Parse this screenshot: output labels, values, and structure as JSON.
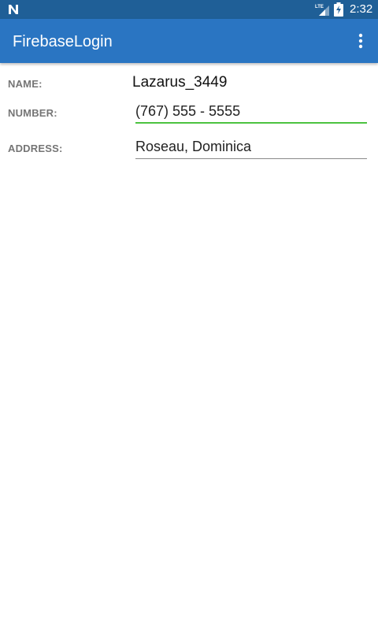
{
  "status_bar": {
    "time": "2:32",
    "network_label": "LTE",
    "icons": [
      "n-notification-icon",
      "lte-signal-icon",
      "battery-charging-icon"
    ]
  },
  "app_bar": {
    "title": "FirebaseLogin",
    "menu_icon": "more-vert-icon"
  },
  "form": {
    "name_label": "NAME:",
    "name_value": "Lazarus_3449",
    "number_label": "NUMBER:",
    "number_value": "(767) 555 - 5555",
    "address_label": "ADDRESS:",
    "address_value": "Roseau, Dominica"
  },
  "colors": {
    "status_bar": "#1f5f97",
    "app_bar": "#2a75c2",
    "focus_underline": "#4cc340",
    "label_text": "#757575"
  }
}
